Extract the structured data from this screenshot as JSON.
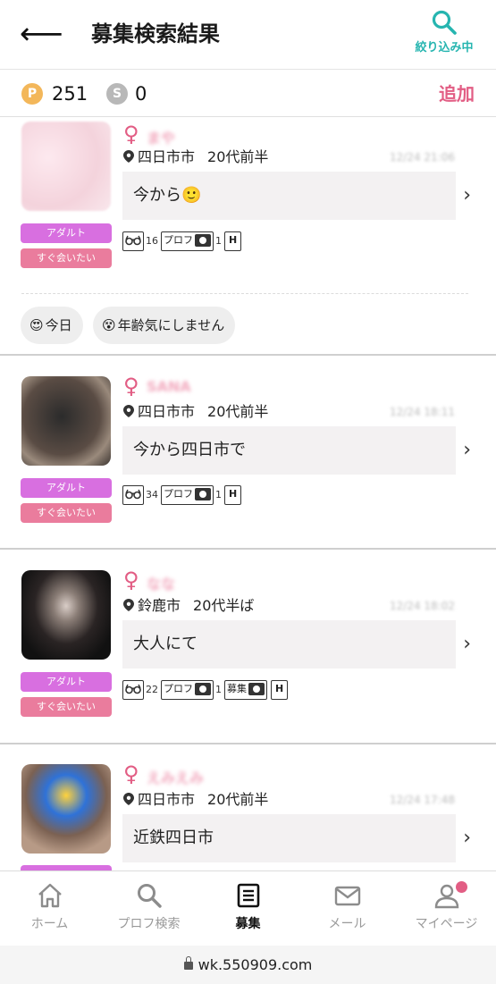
{
  "header": {
    "back_icon": "arrow-left-icon",
    "title": "募集検索結果",
    "filter_icon": "search-icon",
    "filter_label": "絞り込み中",
    "filter_color": "#26b5b0"
  },
  "points": {
    "p_badge": "P",
    "p_value": "251",
    "s_badge": "S",
    "s_value": "0",
    "add_label": "追加",
    "accent": "#e25d84"
  },
  "posts": [
    {
      "gender_symbol": "♀",
      "name": "まや",
      "city": "四日市市",
      "age": "20代前半",
      "time": "12/24 21:06",
      "message": "今から🙂",
      "tags": [
        "アダルト",
        "すぐ会いたい"
      ],
      "views": "16",
      "prof_label": "プロフ",
      "prof_count": "1",
      "h_label": "H",
      "chips": [
        {
          "emoji": "😍",
          "label": "今日"
        },
        {
          "emoji": "😵",
          "label": "年齢気にしません"
        }
      ]
    },
    {
      "gender_symbol": "♀",
      "name": "SANA",
      "city": "四日市市",
      "age": "20代前半",
      "time": "12/24 18:11",
      "message": "今から四日市で",
      "tags": [
        "アダルト",
        "すぐ会いたい"
      ],
      "views": "34",
      "prof_label": "プロフ",
      "prof_count": "1",
      "h_label": "H"
    },
    {
      "gender_symbol": "♀",
      "name": "なな",
      "city": "鈴鹿市",
      "age": "20代半ば",
      "time": "12/24 18:02",
      "message": "大人にて",
      "tags": [
        "アダルト",
        "すぐ会いたい"
      ],
      "views": "22",
      "prof_label": "プロフ",
      "prof_count": "1",
      "boshu_label": "募集",
      "h_label": "H"
    },
    {
      "gender_symbol": "♀",
      "name": "えみえみ",
      "city": "四日市市",
      "age": "20代前半",
      "time": "12/24 17:48",
      "message": "近鉄四日市"
    }
  ],
  "nav": [
    {
      "icon": "home-icon",
      "label": "ホーム"
    },
    {
      "icon": "search-icon",
      "label": "プロフ検索"
    },
    {
      "icon": "list-icon",
      "label": "募集"
    },
    {
      "icon": "mail-icon",
      "label": "メール"
    },
    {
      "icon": "user-icon",
      "label": "マイページ"
    }
  ],
  "url": "wk.550909.com"
}
